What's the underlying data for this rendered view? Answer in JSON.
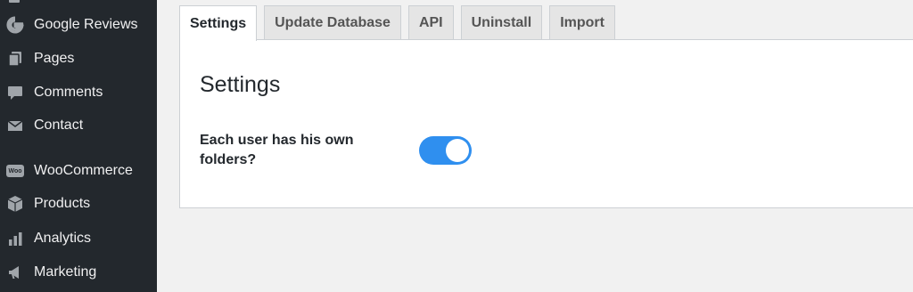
{
  "sidebar": {
    "items": [
      {
        "label": "Google Reviews",
        "icon": "google-icon"
      },
      {
        "label": "Pages",
        "icon": "pages-icon"
      },
      {
        "label": "Comments",
        "icon": "comments-icon"
      },
      {
        "label": "Contact",
        "icon": "envelope-icon"
      },
      {
        "label": "WooCommerce",
        "icon": "woocommerce-icon",
        "icon_text": "Woo"
      },
      {
        "label": "Products",
        "icon": "box-icon"
      },
      {
        "label": "Analytics",
        "icon": "bar-chart-icon"
      },
      {
        "label": "Marketing",
        "icon": "megaphone-icon"
      }
    ]
  },
  "tabs": [
    {
      "label": "Settings",
      "active": true
    },
    {
      "label": "Update Database",
      "active": false
    },
    {
      "label": "API",
      "active": false
    },
    {
      "label": "Uninstall",
      "active": false
    },
    {
      "label": "Import",
      "active": false
    }
  ],
  "panel": {
    "title": "Settings",
    "field_label": "Each user has his own folders?",
    "toggle_on": true
  },
  "colors": {
    "sidebar_bg": "#23282d",
    "toggle_on": "#2f8fef",
    "page_bg": "#f1f1f1"
  }
}
